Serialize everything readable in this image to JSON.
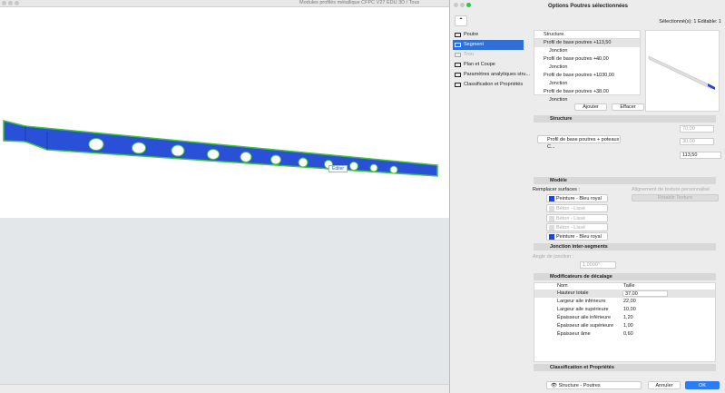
{
  "main_window": {
    "title": "Modules profilés métallique CFPC V27 EDU 3D / Tous",
    "edit_label": "Éditer"
  },
  "dialog": {
    "title": "Options Poutres sélectionnées",
    "selection_info": "Sélectionné(s): 1 Editable: 1",
    "nav": [
      {
        "label": "Poutre"
      },
      {
        "label": "Segment",
        "selected": true
      },
      {
        "label": "Trou",
        "disabled": true
      },
      {
        "label": "Plan et Coupe"
      },
      {
        "label": "Paramètres analytiques stru..."
      },
      {
        "label": "Classification et Propriétés"
      }
    ],
    "structure_table": {
      "header": "Structure",
      "rows": [
        {
          "name": "Profil de base poutres +...",
          "value": "113,50"
        },
        {
          "name": "Jonction"
        },
        {
          "name": "Profil de base poutres +...",
          "value": "40,00"
        },
        {
          "name": "Jonction"
        },
        {
          "name": "Profil de base poutres +...",
          "value": "1030,00"
        },
        {
          "name": "Jonction"
        },
        {
          "name": "Profil de base poutres +...",
          "value": "38,00"
        },
        {
          "name": "Jonction"
        }
      ]
    },
    "add_label": "Ajouter",
    "delete_label": "Effacer",
    "structure": {
      "title": "Structure",
      "profile": "Profil de base poutres + poteaux C...",
      "width": "70,00",
      "height": "30,00",
      "length": "113,50"
    },
    "model": {
      "title": "Modèle",
      "replace_label": "Remplacer surfaces :",
      "surfaces": [
        "Peinture - Bleu royal",
        "Béton - Lissé",
        "Béton - Lissé",
        "Béton - Lissé",
        "Peinture - Bleu royal"
      ],
      "texture_label": "Alignement de texture personnalisé",
      "reset_texture": "Rétablir Texture",
      "accent": "#2244dd"
    },
    "junction": {
      "title": "Jonction inter-segments",
      "angle_label": "Angle de jonction :",
      "angle": "1,0000°"
    },
    "offsets": {
      "title": "Modificateurs de décalage",
      "col_name": "Nom",
      "col_size": "Taille",
      "rows": [
        {
          "name": "Hauteur totale",
          "value": "37,00"
        },
        {
          "name": "Largeur aile inférieure",
          "value": "22,00"
        },
        {
          "name": "Largeur aile supérieure",
          "value": "10,00"
        },
        {
          "name": "Épaisseur aile inférieure",
          "value": "1,20"
        },
        {
          "name": "Épaisseur aile supérieure",
          "value": "1,00"
        },
        {
          "name": "Épaisseur âme",
          "value": "0,60"
        }
      ]
    },
    "classification": {
      "title": "Classification et Propriétés"
    },
    "layer": "Structure - Poutres",
    "cancel": "Annuler",
    "ok": "OK"
  }
}
